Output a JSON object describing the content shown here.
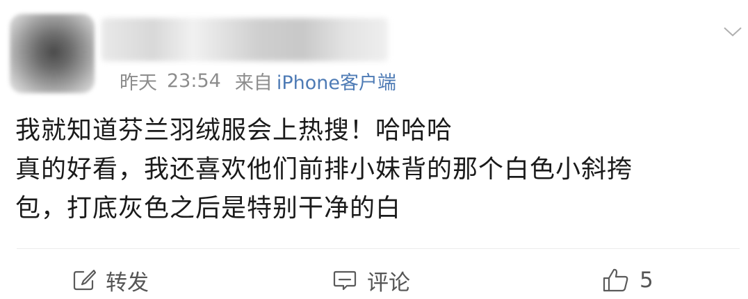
{
  "post": {
    "author": {
      "avatar": "blurred-avatar",
      "name_hidden": true
    },
    "meta": {
      "date": "昨天",
      "time": "23:54",
      "from_label": "来自",
      "client": "iPhone客户端"
    },
    "menu_icon": "chevron-down-icon",
    "content_lines": [
      "我就知道芬兰羽绒服会上热搜！哈哈哈",
      "真的好看，我还喜欢他们前排小妹背的那个白色小斜挎",
      "包，打底灰色之后是特别干净的白"
    ],
    "actions": {
      "repost": {
        "icon": "share-icon",
        "label": "转发"
      },
      "comment": {
        "icon": "comment-icon",
        "label": "评论"
      },
      "like": {
        "icon": "thumbs-up-icon",
        "count": "5"
      }
    }
  },
  "colors": {
    "meta_text": "#8c8c8c",
    "client_link": "#4e7bb5",
    "body_text": "#1a1a1a",
    "action_text": "#555555",
    "divider": "#ececec"
  }
}
